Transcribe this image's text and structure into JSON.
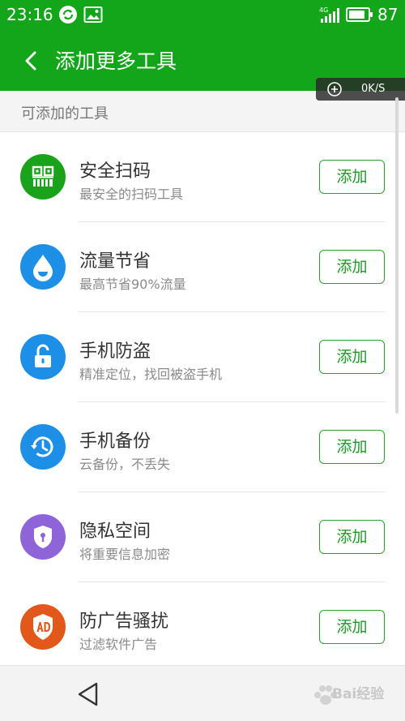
{
  "status_bar": {
    "time": "23:16",
    "network": "4G",
    "battery": "87",
    "battery_level": 0.87
  },
  "app_bar": {
    "title": "添加更多工具"
  },
  "speed_indicator": {
    "value": "0K/S"
  },
  "section": {
    "label": "可添加的工具"
  },
  "tools": [
    {
      "name": "安全扫码",
      "desc": "最安全的扫码工具",
      "button": "添加",
      "icon": "qr-code-icon",
      "color": "#1aa21a"
    },
    {
      "name": "流量节省",
      "desc": "最高节省90%流量",
      "button": "添加",
      "icon": "water-drop-icon",
      "color": "#1e8fe6"
    },
    {
      "name": "手机防盗",
      "desc": "精准定位，找回被盗手机",
      "button": "添加",
      "icon": "unlock-icon",
      "color": "#1e8fe6"
    },
    {
      "name": "手机备份",
      "desc": "云备份，不丢失",
      "button": "添加",
      "icon": "history-icon",
      "color": "#1e8fe6"
    },
    {
      "name": "隐私空间",
      "desc": "将重要信息加密",
      "button": "添加",
      "icon": "shield-keyhole-icon",
      "color": "#8e64d8"
    },
    {
      "name": "防广告骚扰",
      "desc": "过滤软件广告",
      "button": "添加",
      "icon": "ad-block-icon",
      "color": "#e2581a"
    }
  ],
  "watermark": {
    "text": "Bai经验"
  },
  "colors": {
    "brand_green": "#13a61b",
    "button_green": "#1c9a24"
  }
}
